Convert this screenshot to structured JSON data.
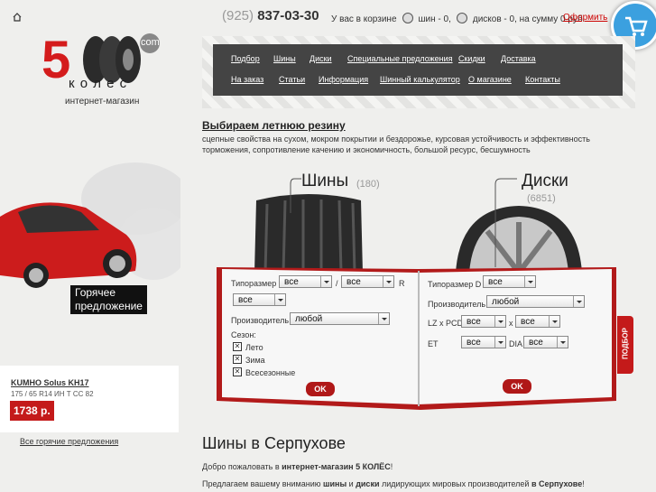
{
  "header": {
    "phone_code": "(925)",
    "phone_number": "837-03-30",
    "cart_prefix": "У вас в корзине",
    "cart_tires": "шин - 0,",
    "cart_disks": "дисков - 0, на сумму 0 руб.",
    "order_link": "Оформить"
  },
  "logo": {
    "number": "5",
    "com": "com",
    "word": "к о л е с",
    "subtitle": "интернет-магазин"
  },
  "nav": {
    "row1": [
      "Подбор",
      "Шины",
      "Диски",
      "Специальные предложения",
      "Скидки",
      "Доставка"
    ],
    "row2": [
      "На заказ",
      "Статьи",
      "Информация",
      "Шинный калькулятор",
      "О магазине",
      "Контакты"
    ]
  },
  "intro": {
    "title": "Выбираем летнюю резину",
    "text": "сцепные свойства на сухом, мокром покрытии и бездорожье, курсовая устойчивость и эффективность торможения, сопротивление качению и экономичность, большой ресурс, бесшумность"
  },
  "hot_offer": {
    "line1": "Горячее",
    "line2": "предложение",
    "product_name": "KUMHO Solus KH17",
    "product_spec": "175 / 65 R14  ИН  Т   СС 82",
    "price": "1738 р.",
    "all_link": "Все горячие предложения"
  },
  "categories": {
    "tires_label": "Шины",
    "tires_count": "(180)",
    "disks_label": "Диски",
    "disks_count": "(6851)"
  },
  "tire_form": {
    "size_label": "Типоразмер",
    "slash": "/",
    "r_label": "R",
    "width_value": "все",
    "profile_value": "все",
    "radius_value": "все",
    "maker_label": "Производитель",
    "maker_value": "любой",
    "season_label": "Сезон:",
    "seasons": [
      "Лето",
      "Зима",
      "Всесезонные"
    ],
    "submit": "OK"
  },
  "disk_form": {
    "size_label": "Типоразмер  D",
    "d_value": "все",
    "maker_label": "Производитель",
    "maker_value": "любой",
    "pcd_label": "LZ x PCD",
    "lz_value": "все",
    "x_label": "x",
    "pcd_value": "все",
    "et_label": "ET",
    "et_value": "все",
    "dia_label": "DIA",
    "dia_value": "все",
    "submit": "OK"
  },
  "side_tab": "ПОДБОР",
  "main": {
    "heading": "Шины в Серпухове",
    "welcome_prefix": "Добро пожаловать в ",
    "welcome_bold": "интернет-магазин 5 КОЛЁС",
    "welcome_suffix": "!",
    "offer_1": "Предлагаем вашему вниманию ",
    "offer_2": "шины",
    "offer_3": " и ",
    "offer_4": "диски",
    "offer_5": " лидирующих мировых производителей ",
    "offer_6": "в Серпухове",
    "offer_7": "!"
  },
  "colors": {
    "accent": "#c41a1a",
    "nav_bg": "#444444",
    "badge": "#3ba0df"
  }
}
